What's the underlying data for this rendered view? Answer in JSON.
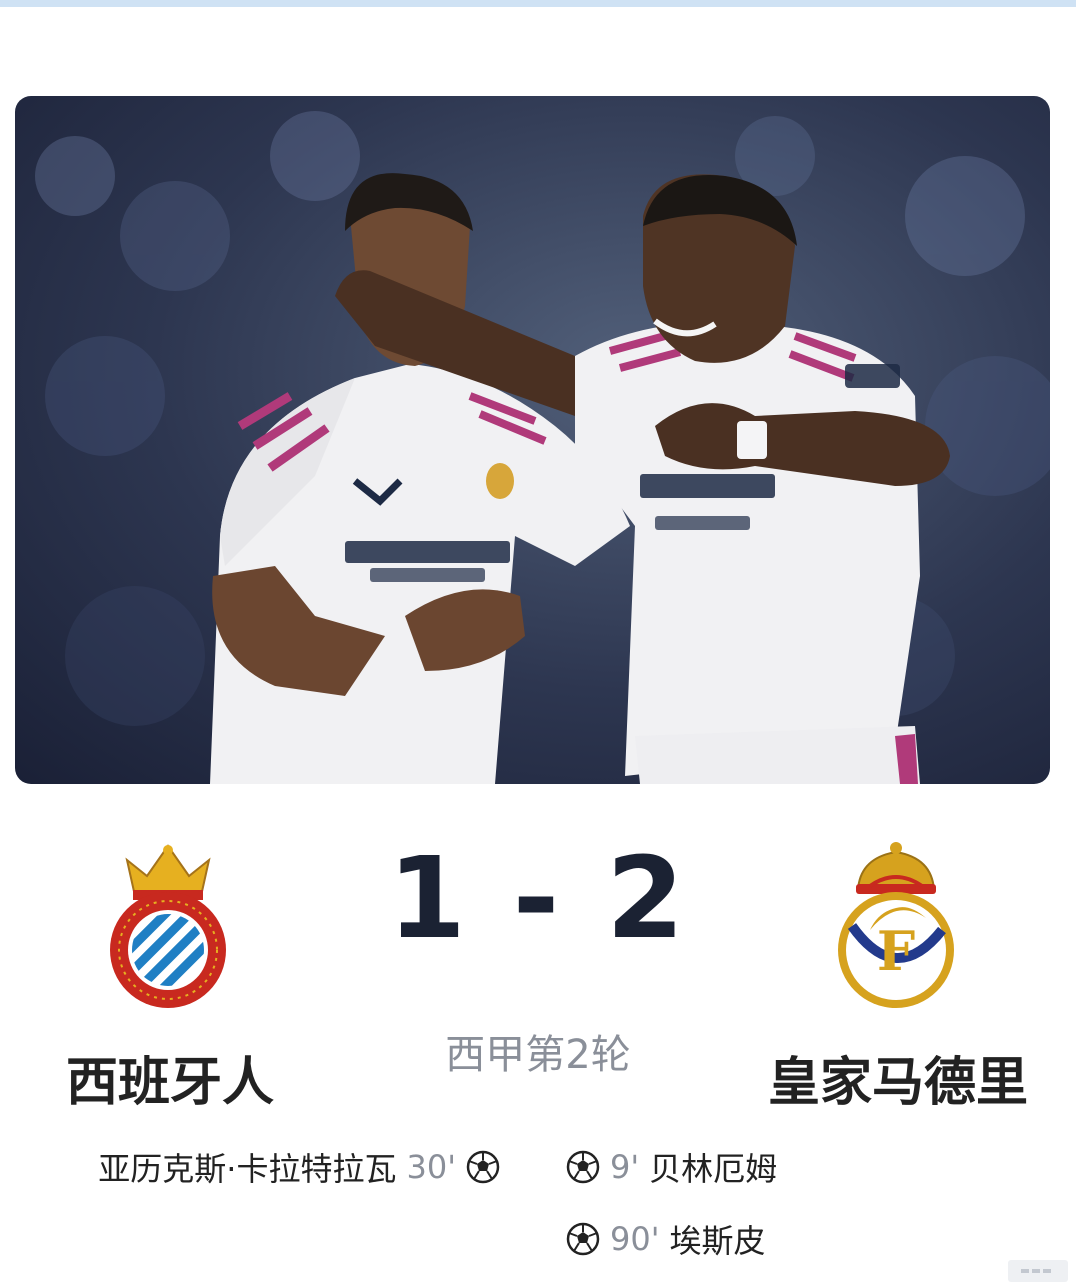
{
  "match": {
    "score": "1 - 2",
    "round": "西甲第2轮"
  },
  "teams": {
    "home": {
      "name": "西班牙人"
    },
    "away": {
      "name": "皇家马德里"
    }
  },
  "scorers": {
    "home": [
      {
        "name": "亚历克斯·卡拉特拉瓦",
        "minute": "30'"
      }
    ],
    "away": [
      {
        "name": "贝林厄姆",
        "minute": "9'"
      },
      {
        "name": "埃斯皮",
        "minute": "90'"
      }
    ]
  },
  "photo": {
    "description_icon": "players-celebrating-image"
  },
  "colors": {
    "score_text": "#1b2233",
    "muted_text": "#8a8f99",
    "espanyol_blue": "#1f7fc4",
    "espanyol_red": "#d3261e",
    "madrid_gold": "#d6a21e",
    "madrid_blue": "#233a8c"
  }
}
